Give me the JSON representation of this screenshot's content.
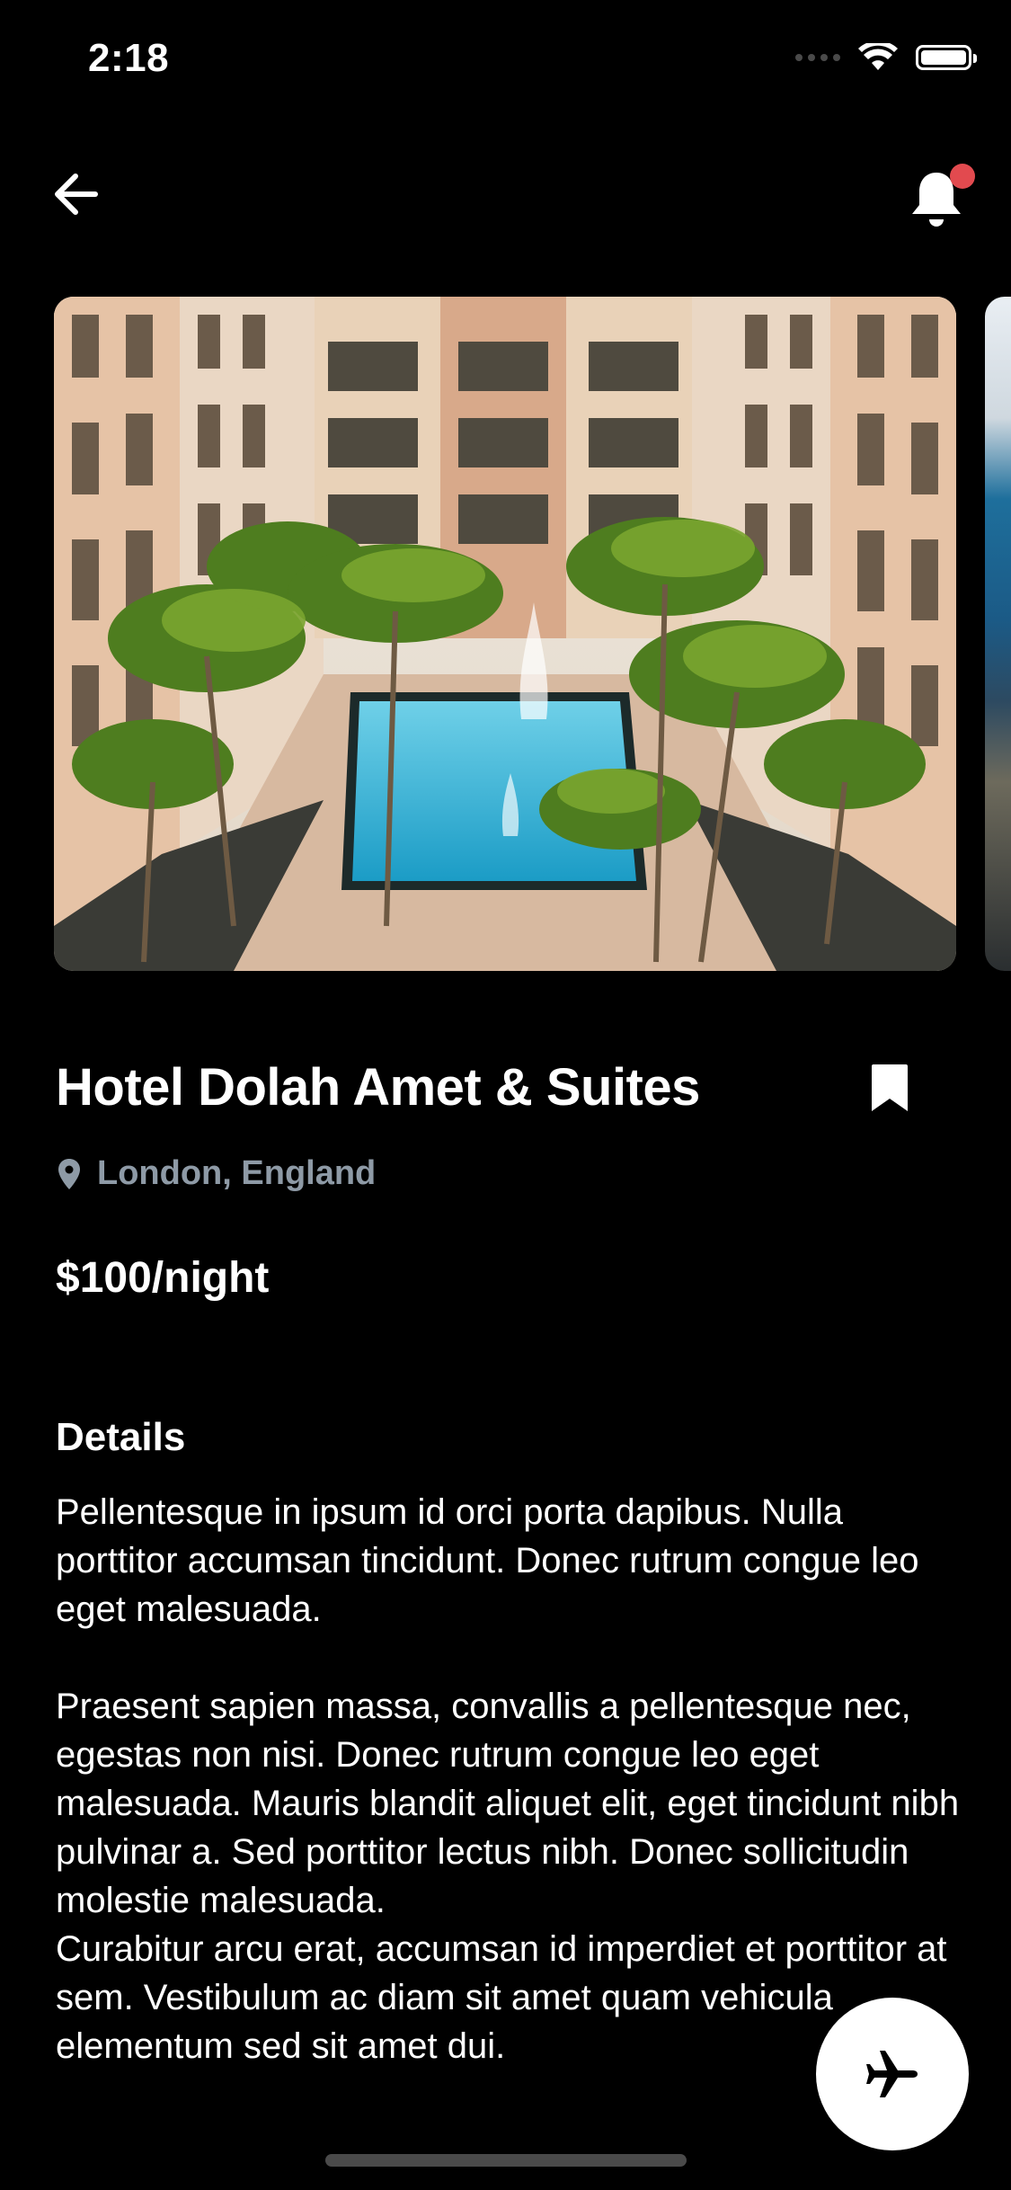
{
  "status_bar": {
    "time": "2:18"
  },
  "nav": {
    "back_icon": "arrow-left-icon",
    "notification_icon": "bell-icon",
    "notification_badge_color": "#e24a4f"
  },
  "hotel": {
    "name": "Hotel Dolah Amet & Suites",
    "location": "London, England",
    "price": "$100/night",
    "bookmark_icon": "bookmark-icon"
  },
  "details": {
    "heading": "Details",
    "paragraphs": [
      "Pellentesque in ipsum id orci porta dapibus. Nulla porttitor accumsan tincidunt. Donec rutrum congue leo eget malesuada.",
      "Praesent sapien massa, convallis a pellentesque nec, egestas non nisi. Donec rutrum congue leo eget malesuada. Mauris blandit aliquet elit, eget tincidunt nibh pulvinar a. Sed porttitor lectus nibh. Donec sollicitudin molestie malesuada.",
      "Curabitur arcu erat, accumsan id imperdiet et porttitor at sem. Vestibulum ac diam sit amet quam vehicula elementum sed sit amet dui."
    ]
  },
  "fab": {
    "icon": "airplane-icon"
  },
  "colors": {
    "background": "#000000",
    "muted_text": "#8e9aa6",
    "fab_background": "#ffffff"
  }
}
